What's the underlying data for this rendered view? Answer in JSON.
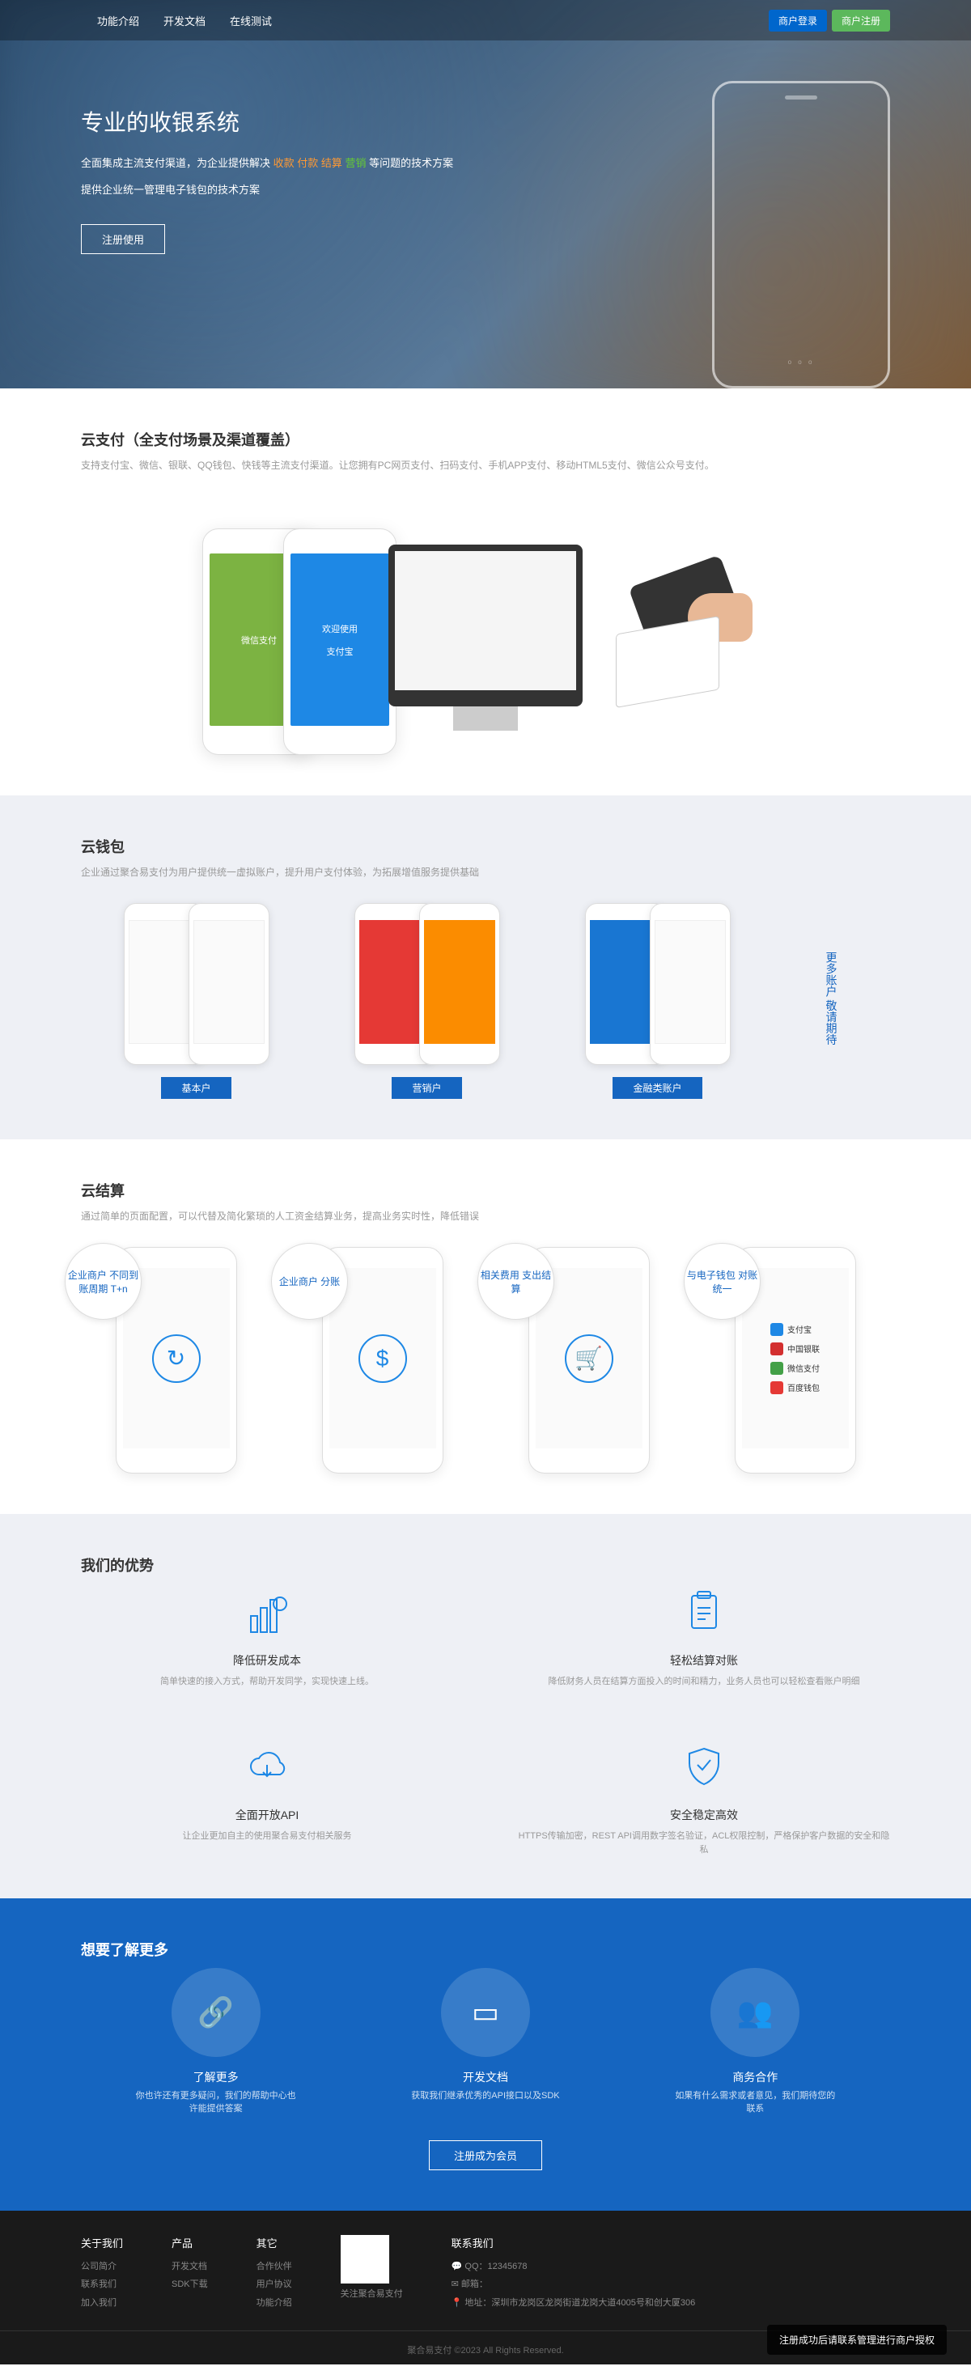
{
  "nav": {
    "items": [
      "功能介绍",
      "开发文档",
      "在线测试"
    ]
  },
  "header": {
    "login": "商户登录",
    "register": "商户注册"
  },
  "hero": {
    "title": "专业的收银系统",
    "line1_a": "全面集成主流支付渠道，为企业提供解决 ",
    "line1_hl1": "收款 付款 结算 ",
    "line1_hl2": "营销",
    "line1_b": " 等问题的技术方案",
    "line2": "提供企业统一管理电子钱包的技术方案",
    "btn": "注册使用"
  },
  "cloudpay": {
    "title": "云支付（全支付场景及渠道覆盖）",
    "desc": "支持支付宝、微信、银联、QQ钱包、快钱等主流支付渠道。让您拥有PC网页支付、扫码支付、手机APP支付、移动HTML5支付、微信公众号支付。",
    "wechat": "微信支付",
    "alipay": "支付宝",
    "welcome": "欢迎使用"
  },
  "wallet": {
    "title": "云钱包",
    "desc": "企业通过聚合易支付为用户提供统一虚拟账户，提升用户支付体验，为拓展增值服务提供基础",
    "btns": [
      "基本户",
      "营销户",
      "金融类账户"
    ],
    "more": "更多账户 敬请期待"
  },
  "settle": {
    "title": "云结算",
    "desc": "通过简单的页面配置，可以代替及简化繁琐的人工资金结算业务，提高业务实时性，降低错误",
    "badges": [
      "企业商户\n不同到账周期\nT+n",
      "企业商户\n分账",
      "相关费用\n支出结算",
      "与电子钱包\n对账统一"
    ],
    "pays": [
      "支付宝",
      "中国银联",
      "微信支付",
      "百度钱包"
    ]
  },
  "adv": {
    "title": "我们的优势",
    "items": [
      {
        "t": "降低研发成本",
        "d": "简单快速的接入方式，帮助开发同学，实现快速上线。"
      },
      {
        "t": "轻松结算对账",
        "d": "降低财务人员在结算方面投入的时间和精力，业务人员也可以轻松查看账户明细"
      },
      {
        "t": "全面开放API",
        "d": "让企业更加自主的使用聚合易支付相关服务"
      },
      {
        "t": "安全稳定高效",
        "d": "HTTPS传输加密，REST API调用数字签名验证，ACL权限控制，严格保护客户数据的安全和隐私"
      }
    ]
  },
  "learn": {
    "title": "想要了解更多",
    "items": [
      {
        "t": "了解更多",
        "d": "你也许还有更多疑问，我们的帮助中心也许能提供答案"
      },
      {
        "t": "开发文档",
        "d": "获取我们继承优秀的API接口以及SDK"
      },
      {
        "t": "商务合作",
        "d": "如果有什么需求或者意见，我们期待您的联系"
      }
    ],
    "btn": "注册成为会员"
  },
  "footer": {
    "cols": [
      {
        "h": "关于我们",
        "links": [
          "公司简介",
          "联系我们",
          "加入我们"
        ]
      },
      {
        "h": "产品",
        "links": [
          "开发文档",
          "SDK下载"
        ]
      },
      {
        "h": "其它",
        "links": [
          "合作伙伴",
          "用户协议",
          "功能介绍"
        ]
      }
    ],
    "qr_label": "关注聚合易支付",
    "contact": {
      "h": "联系我们",
      "qq": "QQ：12345678",
      "email": "邮箱：",
      "addr": "地址：深圳市龙岗区龙岗街道龙岗大道4005号和创大厦306"
    },
    "copyright": "聚合易支付 ©2023 All Rights Reserved."
  },
  "toast": "注册成功后请联系管理进行商户授权"
}
